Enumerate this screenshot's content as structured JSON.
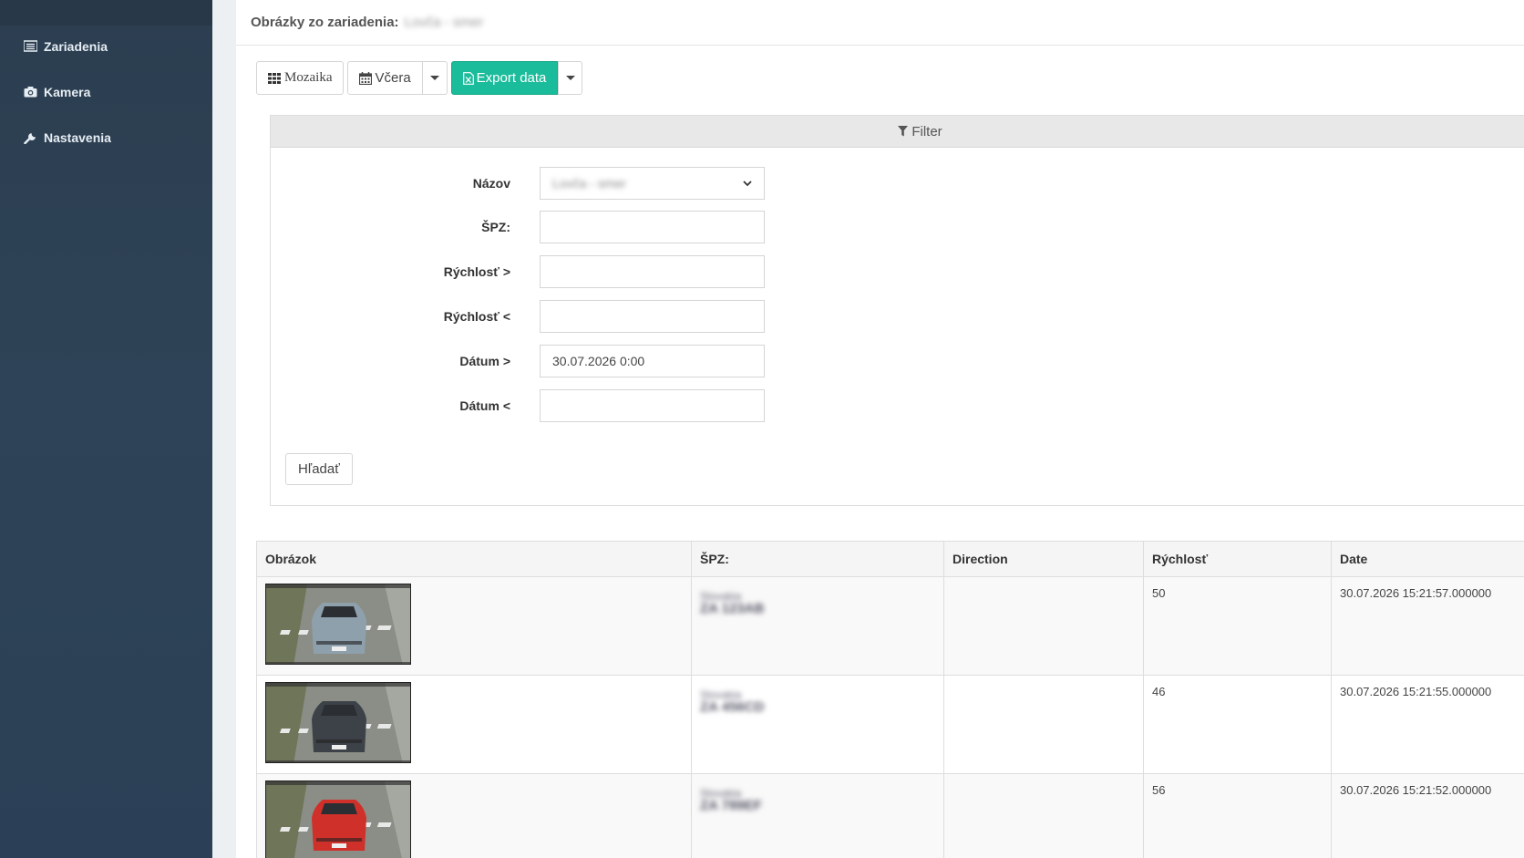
{
  "sidebar": {
    "items": [
      {
        "label": "Zariadenia",
        "icon": "list-icon"
      },
      {
        "label": "Kamera",
        "icon": "camera-icon"
      },
      {
        "label": "Nastavenia",
        "icon": "wrench-icon"
      }
    ]
  },
  "header": {
    "title": "Obrázky zo zariadenia:",
    "device_name": "Lovča - smer"
  },
  "toolbar": {
    "mozaika_label": "Mozaika",
    "vcera_label": "Včera",
    "export_label": "Export data"
  },
  "filter": {
    "title": "Filter",
    "fields": [
      {
        "label": "Názov",
        "value": "Lovča - smer",
        "type": "select"
      },
      {
        "label": "ŠPZ:",
        "value": ""
      },
      {
        "label": "Rýchlosť >",
        "value": ""
      },
      {
        "label": "Rýchlosť <",
        "value": ""
      },
      {
        "label": "Dátum >",
        "value": "30.07.2026 0:00"
      },
      {
        "label": "Dátum <",
        "value": ""
      }
    ],
    "search_label": "Hľadať"
  },
  "table": {
    "headers": [
      "Obrázok",
      "ŠPZ:",
      "Direction",
      "Rýchlosť",
      "Date"
    ],
    "rows": [
      {
        "plate_small": "Slovakia",
        "plate": "ZA 123AB",
        "direction": "",
        "speed": "50",
        "date": "30.07.2026 15:21:57.000000",
        "car_color": "#8fa0ad"
      },
      {
        "plate_small": "Slovakia",
        "plate": "ZA 456CD",
        "direction": "",
        "speed": "46",
        "date": "30.07.2026 15:21:55.000000",
        "car_color": "#3c4248"
      },
      {
        "plate_small": "Slovakia",
        "plate": "ZA 789EF",
        "direction": "",
        "speed": "56",
        "date": "30.07.2026 15:21:52.000000",
        "car_color": "#d0302a"
      }
    ]
  },
  "colors": {
    "sidebar": "#2c3e50",
    "accent": "#1bbc9b"
  }
}
